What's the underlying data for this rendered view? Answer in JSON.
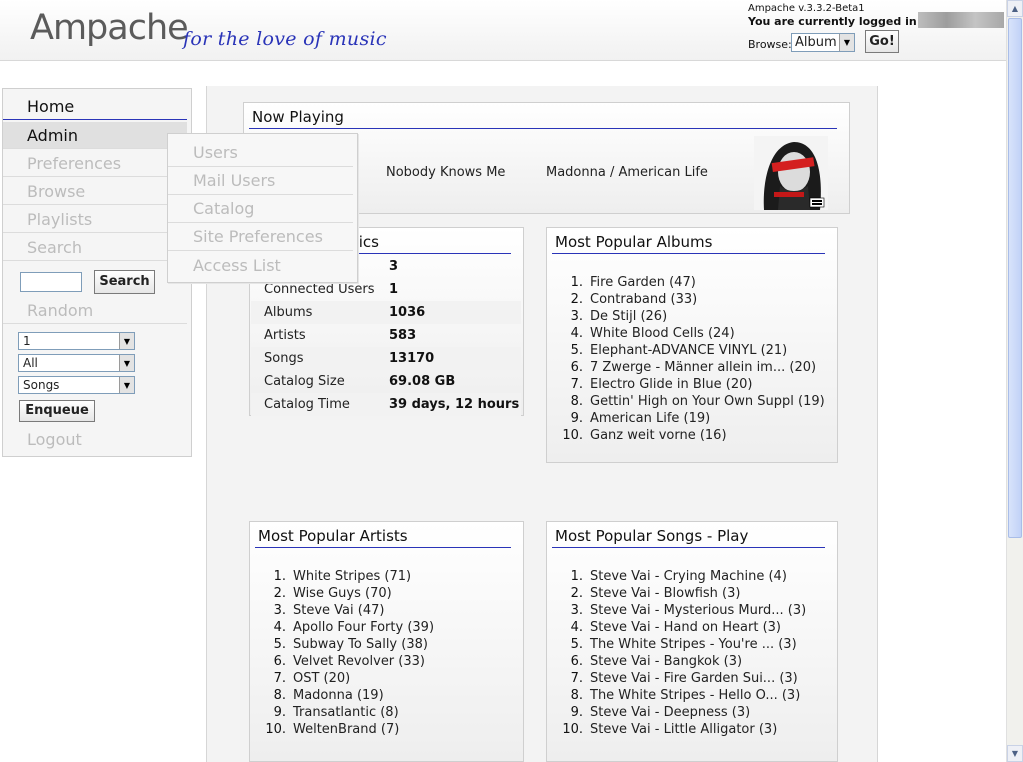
{
  "header": {
    "logo_text": "Ampache",
    "tagline": "for the love of music",
    "version": "Ampache v.3.3.2-Beta1",
    "logged_in_text": "You are currently logged in as",
    "browse_label": "Browse:",
    "browse_value": "Album",
    "go_label": "Go!"
  },
  "sidebar": {
    "items": [
      {
        "label": "Home"
      },
      {
        "label": "Admin"
      },
      {
        "label": "Preferences"
      },
      {
        "label": "Browse"
      },
      {
        "label": "Playlists"
      },
      {
        "label": "Search"
      }
    ],
    "search_button": "Search",
    "random_label": "Random",
    "random_count": "1",
    "random_scope": "All",
    "random_type": "Songs",
    "enqueue_label": "Enqueue",
    "logout_label": "Logout"
  },
  "admin_menu": {
    "items": [
      "Users",
      "Mail Users",
      "Catalog",
      "Site Preferences",
      "Access List"
    ]
  },
  "now_playing": {
    "title": "Now Playing",
    "song": "Nobody Knows Me",
    "artist_album": "Madonna / American Life"
  },
  "stats": {
    "title_visible": "stics",
    "rows": [
      {
        "label": "",
        "value": "3"
      },
      {
        "label": "Connected Users",
        "value": "1"
      },
      {
        "label": "Albums",
        "value": "1036"
      },
      {
        "label": "Artists",
        "value": "583"
      },
      {
        "label": "Songs",
        "value": "13170"
      },
      {
        "label": "Catalog Size",
        "value": "69.08 GB"
      },
      {
        "label": "Catalog Time",
        "value": "39 days, 12 hours"
      }
    ]
  },
  "popular_albums": {
    "title": "Most Popular Albums",
    "items": [
      "Fire Garden (47)",
      "Contraband (33)",
      "De Stijl (26)",
      "White Blood Cells (24)",
      "Elephant-ADVANCE VINYL (21)",
      "7 Zwerge - Männer allein im... (20)",
      "Electro Glide in Blue (20)",
      "Gettin' High on Your Own Suppl (19)",
      "American Life (19)",
      "Ganz weit vorne (16)"
    ]
  },
  "popular_artists": {
    "title": "Most Popular Artists",
    "items": [
      "White Stripes (71)",
      "Wise Guys (70)",
      "Steve Vai (47)",
      "Apollo Four Forty (39)",
      "Subway To Sally (38)",
      "Velvet Revolver (33)",
      "OST (20)",
      "Madonna (19)",
      "Transatlantic (8)",
      "WeltenBrand (7)"
    ]
  },
  "popular_songs": {
    "title": "Most Popular Songs - Play",
    "items": [
      "Steve Vai - Crying Machine (4)",
      "Steve Vai - Blowfish (3)",
      "Steve Vai - Mysterious Murd... (3)",
      "Steve Vai - Hand on Heart (3)",
      "The White Stripes - You're ... (3)",
      "Steve Vai - Bangkok (3)",
      "Steve Vai - Fire Garden Sui... (3)",
      "The White Stripes - Hello O... (3)",
      "Steve Vai - Deepness (3)",
      "Steve Vai - Little Alligator (3)"
    ]
  },
  "colors": {
    "accent": "#2a34b8",
    "disabled_text": "#bcbcbc"
  }
}
